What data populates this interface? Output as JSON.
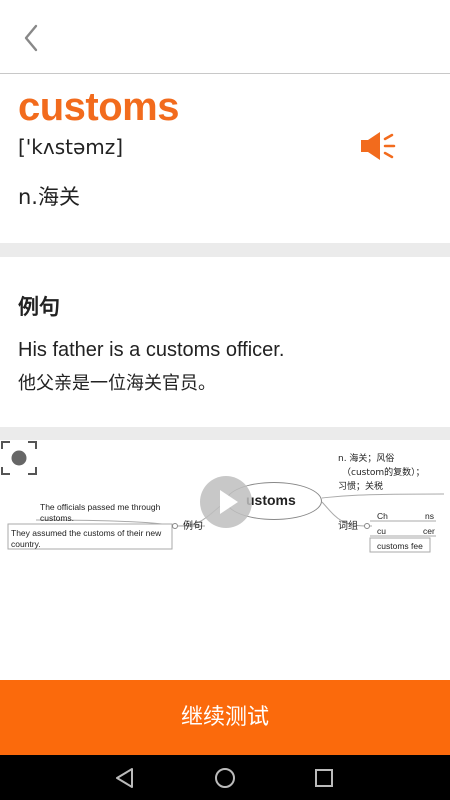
{
  "word": {
    "headword": "customs",
    "phonetic": "['kʌstəmz]",
    "definition": "n.海关"
  },
  "example": {
    "section_title": "例句",
    "sentence_en": "His father is a customs officer.",
    "sentence_zh": "他父亲是一位海关官员。"
  },
  "mindmap": {
    "center": "ustoms",
    "branch_left": "例句",
    "branch_right": "词组",
    "left_sentence_1": "The officials passed me through customs.",
    "left_sentence_2": "They assumed the customs of their new country.",
    "meaning_line1": "n. 海关；风俗",
    "meaning_line2": "（custom的复数）；",
    "meaning_line3": "习惯；关税",
    "phrase_1a": "Ch",
    "phrase_1b": "ns",
    "phrase_2a": "cu",
    "phrase_2b": "cer",
    "phrase_3": "customs fee"
  },
  "cta": {
    "label": "继续测试"
  },
  "colors": {
    "accent": "#fb6a0c",
    "headword": "#f26b1d",
    "separator": "#ebebeb"
  },
  "icons": [
    "back-arrow-icon",
    "speaker-icon",
    "play-icon",
    "focus-capture-icon",
    "nav-back-icon",
    "nav-home-icon",
    "nav-recents-icon"
  ]
}
